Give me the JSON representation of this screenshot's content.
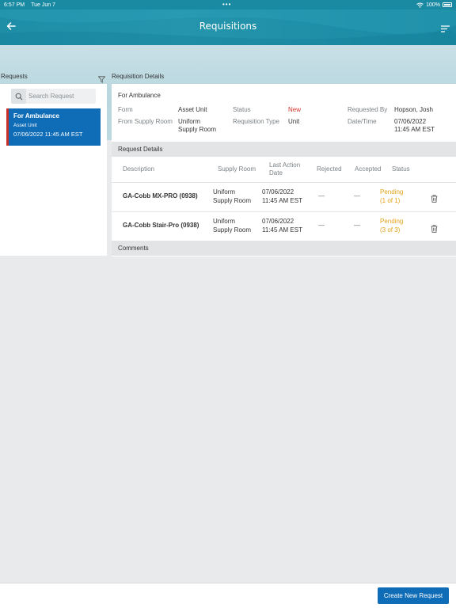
{
  "status_bar": {
    "time": "6:57 PM",
    "date": "Tue Jun 7",
    "battery": "100%"
  },
  "header": {
    "title": "Requisitions"
  },
  "left": {
    "label": "Requests",
    "search_placeholder": "Search Request",
    "selected_request": {
      "title": "For Ambulance",
      "subtitle": "Asset Unit",
      "datetime": "07/06/2022   11:45 AM EST"
    }
  },
  "details": {
    "label": "Requisition Details",
    "title": "For Ambulance",
    "form_label": "Form",
    "form_value": "Asset Unit",
    "supply_label": "From Supply Room",
    "supply_value_1": "Uniform",
    "supply_value_2": "Supply Room",
    "status_label": "Status",
    "status_value": "New",
    "type_label": "Requisition Type",
    "type_value": "Unit",
    "requested_label": "Requested By",
    "requested_value": "Hopson, Josh",
    "datetime_label": "Date/Time",
    "datetime_value_1": "07/06/2022",
    "datetime_value_2": "11:45 AM EST"
  },
  "request_details": {
    "label": "Request Details",
    "columns": {
      "description": "Description",
      "supply_room": "Supply Room",
      "last_action_1": "Last Action",
      "last_action_2": "Date",
      "rejected": "Rejected",
      "accepted": "Accepted",
      "status": "Status"
    },
    "rows": [
      {
        "description": "GA-Cobb MX-PRO (0938)",
        "supply_1": "Uniform",
        "supply_2": "Supply Room",
        "date_1": "07/06/2022",
        "date_2": "11:45 AM EST",
        "rejected": "—",
        "accepted": "—",
        "status_1": "Pending",
        "status_2": "(1 of 1)"
      },
      {
        "description": "GA-Cobb Stair-Pro (0938)",
        "supply_1": "Uniform",
        "supply_2": "Supply Room",
        "date_1": "07/06/2022",
        "date_2": "11:45 AM EST",
        "rejected": "—",
        "accepted": "—",
        "status_1": "Pending",
        "status_2": "(3 of 3)"
      }
    ]
  },
  "comments": {
    "label": "Comments"
  },
  "footer": {
    "create_button": "Create New Request"
  },
  "colors": {
    "header": "#1e8ea7",
    "primary": "#0f6cb6",
    "pending": "#e3a21a",
    "new_status": "#d0342c"
  }
}
